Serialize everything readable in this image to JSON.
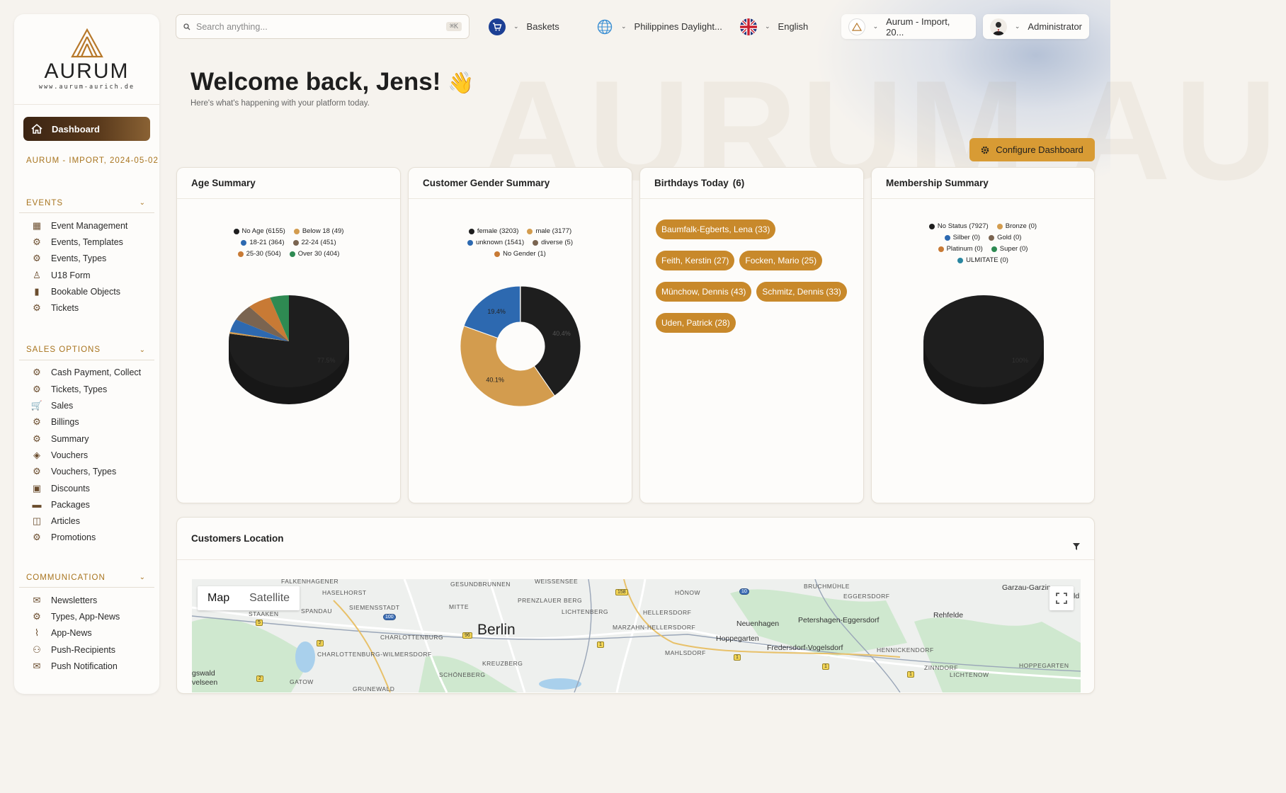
{
  "colors": {
    "accent": "#c8892b",
    "accent_text": "#a8741e",
    "dark": "#1e1e1e",
    "config_button": "#d89b34"
  },
  "sidebar": {
    "logo": {
      "word": "AURUM",
      "url": "www.aurum-aurich.de"
    },
    "dashboard_label": "Dashboard",
    "client_label": "AURUM - IMPORT, 2024-05-02",
    "sections": [
      {
        "title": "EVENTS",
        "items": [
          {
            "label": "Event Management",
            "icon": "calendar-icon"
          },
          {
            "label": "Events, Templates",
            "icon": "gear-icon"
          },
          {
            "label": "Events, Types",
            "icon": "gear-icon"
          },
          {
            "label": "U18 Form",
            "icon": "child-icon"
          },
          {
            "label": "Bookable Objects",
            "icon": "book-icon"
          },
          {
            "label": "Tickets",
            "icon": "gear-icon"
          }
        ]
      },
      {
        "title": "SALES OPTIONS",
        "items": [
          {
            "label": "Cash Payment, Collect",
            "icon": "gear-icon"
          },
          {
            "label": "Tickets, Types",
            "icon": "gear-icon"
          },
          {
            "label": "Sales",
            "icon": "cart-icon"
          },
          {
            "label": "Billings",
            "icon": "gear-icon"
          },
          {
            "label": "Summary",
            "icon": "gear-icon"
          },
          {
            "label": "Vouchers",
            "icon": "tags-icon"
          },
          {
            "label": "Vouchers, Types",
            "icon": "gear-icon"
          },
          {
            "label": "Discounts",
            "icon": "money-icon"
          },
          {
            "label": "Packages",
            "icon": "archive-icon"
          },
          {
            "label": "Articles",
            "icon": "cubes-icon"
          },
          {
            "label": "Promotions",
            "icon": "gear-icon"
          }
        ]
      },
      {
        "title": "COMMUNICATION",
        "items": [
          {
            "label": "Newsletters",
            "icon": "envelope-icon"
          },
          {
            "label": "Types, App-News",
            "icon": "gear-icon"
          },
          {
            "label": "App-News",
            "icon": "paperclip-icon"
          },
          {
            "label": "Push-Recipients",
            "icon": "users-icon"
          },
          {
            "label": "Push Notification",
            "icon": "envelope-outline-icon"
          }
        ]
      }
    ]
  },
  "topbar": {
    "search_placeholder": "Search anything...",
    "search_shortcut": "⌘K",
    "baskets_label": "Baskets",
    "timezone_label": "Philippines Daylight...",
    "language_label": "English",
    "client_label": "Aurum - Import, 20...",
    "user_label": "Administrator"
  },
  "welcome": {
    "title": "Welcome back, Jens!",
    "emoji": "👋",
    "subtitle": "Here's what's happening with your platform today.",
    "watermark": "AURUM AURUM"
  },
  "config_button_label": "Configure Dashboard",
  "cards": {
    "age": {
      "title": "Age Summary",
      "legend": [
        {
          "label": "No Age (6155)",
          "color": "#1e1e1e"
        },
        {
          "label": "Below 18 (49)",
          "color": "#d39c4e"
        },
        {
          "label": "18-21 (364)",
          "color": "#2d69b0"
        },
        {
          "label": "22-24 (451)",
          "color": "#7a6450"
        },
        {
          "label": "25-30 (504)",
          "color": "#c87a35"
        },
        {
          "label": "Over 30 (404)",
          "color": "#2e8a52"
        }
      ],
      "slice_label": "77.5%"
    },
    "gender": {
      "title": "Customer Gender Summary",
      "legend": [
        {
          "label": "female (3203)",
          "color": "#1e1e1e"
        },
        {
          "label": "male (3177)",
          "color": "#d39c4e"
        },
        {
          "label": "unknown (1541)",
          "color": "#2d69b0"
        },
        {
          "label": "diverse (5)",
          "color": "#7a6450"
        },
        {
          "label": "No Gender (1)",
          "color": "#c87a35"
        }
      ],
      "slice_labels": [
        "40.4%",
        "40.1%",
        "19.4%"
      ]
    },
    "birthdays": {
      "title": "Birthdays Today",
      "count": "(6)",
      "people": [
        "Baumfalk-Egberts, Lena (33)",
        "Feith, Kerstin (27)",
        "Focken, Mario (25)",
        "Münchow, Dennis  (43)",
        "Schmitz, Dennis (33)",
        "Uden, Patrick (28)"
      ]
    },
    "membership": {
      "title": "Membership Summary",
      "legend": [
        {
          "label": "No Status (7927)",
          "color": "#1e1e1e"
        },
        {
          "label": "Bronze (0)",
          "color": "#d39c4e"
        },
        {
          "label": "Silber (0)",
          "color": "#2d69b0"
        },
        {
          "label": "Gold (0)",
          "color": "#7a6450"
        },
        {
          "label": "Platinum (0)",
          "color": "#c87a35"
        },
        {
          "label": "Super (0)",
          "color": "#2e8a52"
        },
        {
          "label": "ULMITATE (0)",
          "color": "#2a86a0"
        }
      ],
      "slice_label": "100%"
    },
    "location": {
      "title": "Customers Location",
      "map_tabs": [
        "Map",
        "Satellite"
      ],
      "labels": {
        "city": "Berlin",
        "towns": [
          "Neuenhagen",
          "Petershagen-Eggersdorf",
          "Hoppegarten",
          "Fredersdorf-Vogelsdorf",
          "Rehfelde",
          "Garzau-Garzin"
        ],
        "districts": [
          "FALKENHAGENER",
          "HASELHORST",
          "SPANDAU",
          "STAAKEN",
          "SIEMENSSTADT",
          "CHARLOTTENBURG",
          "CHARLOTTENBURG-WILMERSDORF",
          "GESUNDBRUNNEN",
          "MITTE",
          "PRENZLAUER BERG",
          "WEISSENSEE",
          "LICHTENBERG",
          "HELLERSDORF",
          "MARZAHN-HELLERSDORF",
          "MAHLSDORF",
          "KREUZBERG",
          "SCHÖNEBERG",
          "HÖNOW",
          "BRUCHMÜHLE",
          "EGGERSDORF",
          "HENNICKENDORF",
          "ZINNDORF",
          "LICHTENOW",
          "HOPPEGARTEN",
          "GATOW",
          "GRUNEWALD"
        ],
        "edge": [
          "gswald",
          "velseen",
          "ld"
        ],
        "shields": [
          "5",
          "2",
          "2",
          "100",
          "96",
          "158",
          "1",
          "10",
          "1",
          "1",
          "1"
        ]
      }
    }
  }
}
